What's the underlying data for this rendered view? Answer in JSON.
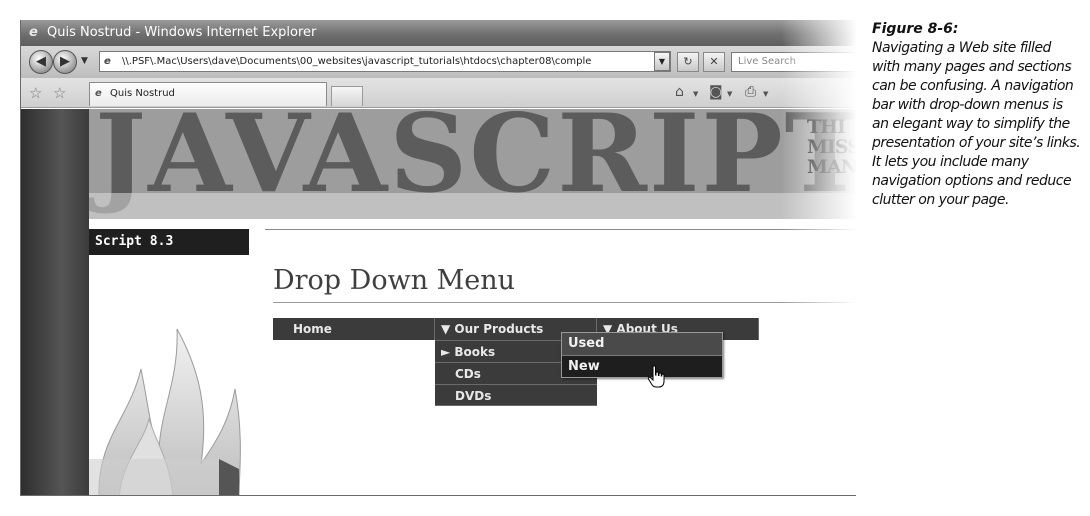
{
  "browser": {
    "window_title": "Quis Nostrud - Windows Internet Explorer",
    "address": "\\\\.PSF\\.Mac\\Users\\dave\\Documents\\00_websites\\javascript_tutorials\\htdocs\\chapter08\\comple",
    "search_placeholder": "Live Search",
    "tab_title": "Quis Nostrud"
  },
  "page": {
    "banner_text": "JAVASCRIPT",
    "banner_sub": "THI\nMISS\nMAN",
    "script_label": "Script 8.3",
    "heading": "Drop Down Menu"
  },
  "nav": {
    "home": "Home",
    "products": "▼ Our Products",
    "about": "▼ About Us"
  },
  "dropdown": {
    "books": "► Books",
    "cds": "CDs",
    "dvds": "DVDs"
  },
  "submenu": {
    "used": "Used",
    "new": "New"
  },
  "caption": {
    "label": "Figure 8-6:",
    "text": "Navigating a Web site filled with many pages and sections can be confusing. A navigation bar with drop-down menus is an elegant way to simplify the presentation of your site’s links. It lets you include many navigation options and reduce clutter on your page."
  }
}
